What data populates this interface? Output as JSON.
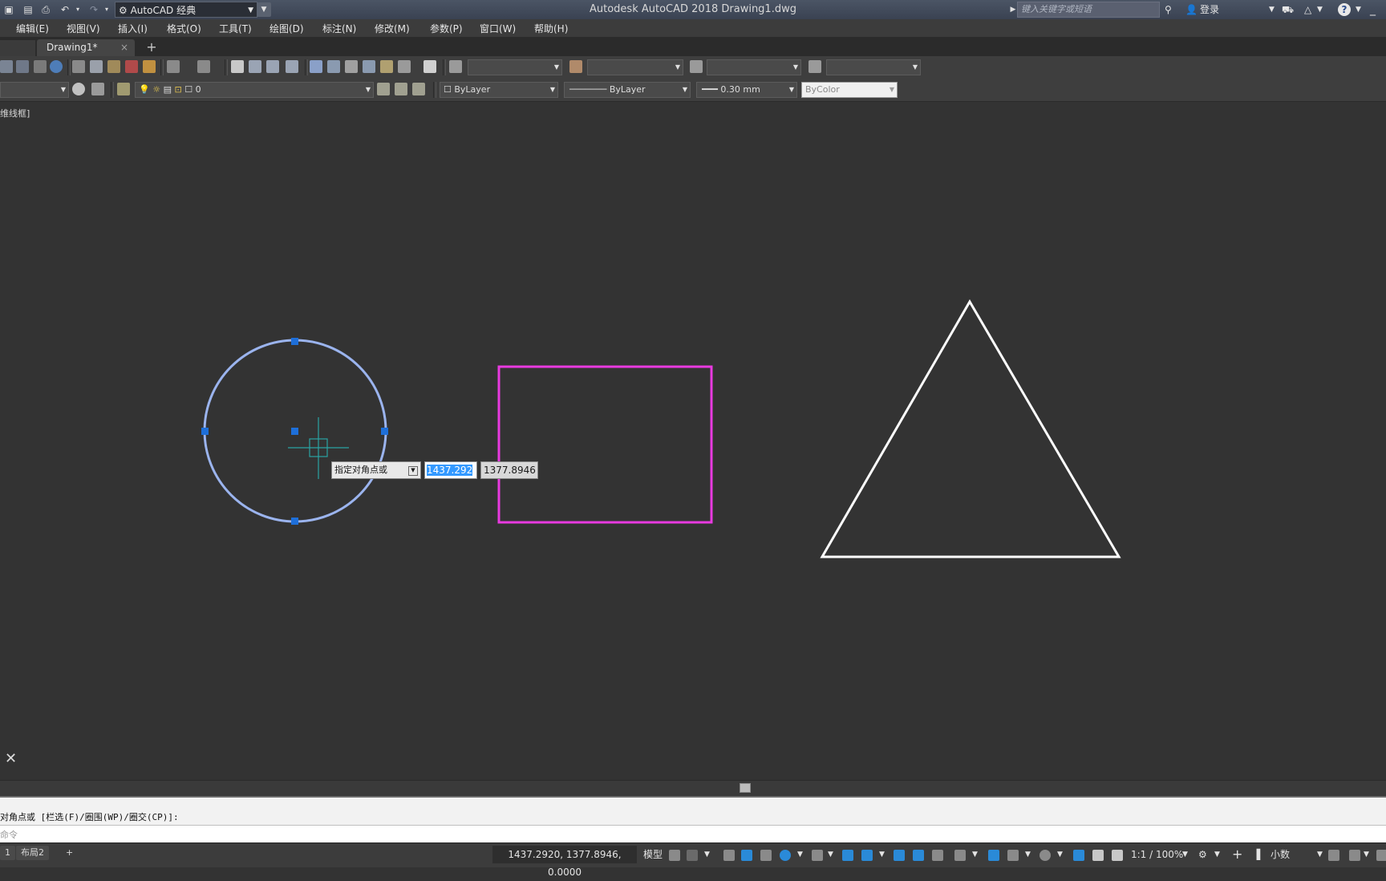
{
  "titlebar": {
    "workspace": "AutoCAD 经典",
    "app_title": "Autodesk AutoCAD 2018    Drawing1.dwg",
    "search_placeholder": "键入关键字或短语",
    "login": "登录"
  },
  "menu": {
    "items": [
      "编辑(E)",
      "视图(V)",
      "插入(I)",
      "格式(O)",
      "工具(T)",
      "绘图(D)",
      "标注(N)",
      "修改(M)",
      "参数(P)",
      "窗口(W)",
      "帮助(H)"
    ]
  },
  "tabs": {
    "drawing": "Drawing1*",
    "close": "×",
    "add": "+"
  },
  "layers_toolbar": {
    "layer_name": "0",
    "color": "ByLayer",
    "linetype": "ByLayer",
    "lineweight": "0.30 mm",
    "plotstyle": "ByColor"
  },
  "viewport": {
    "label": "维线框]",
    "prompt": "指定对角点或",
    "x_value": "1437.292",
    "y_value": "1377.8946"
  },
  "command": {
    "history": "对角点或 [栏选(F)/圈围(WP)/圈交(CP)]:",
    "input_placeholder": "命令"
  },
  "statusbar": {
    "layout1": "1",
    "layout2": "布局2",
    "add": "+",
    "coordinates": "1437.2920, 1377.8946, 0.0000",
    "model": "模型",
    "scale": "1:1 / 100%",
    "units": "小数"
  },
  "colors": {
    "background": "#333333",
    "circle_selected": "#9bb4ee",
    "grip": "#1e6fd9",
    "rectangle": "#e93ae0",
    "triangle": "#ffffff",
    "crosshair": "#2aa3a3"
  }
}
